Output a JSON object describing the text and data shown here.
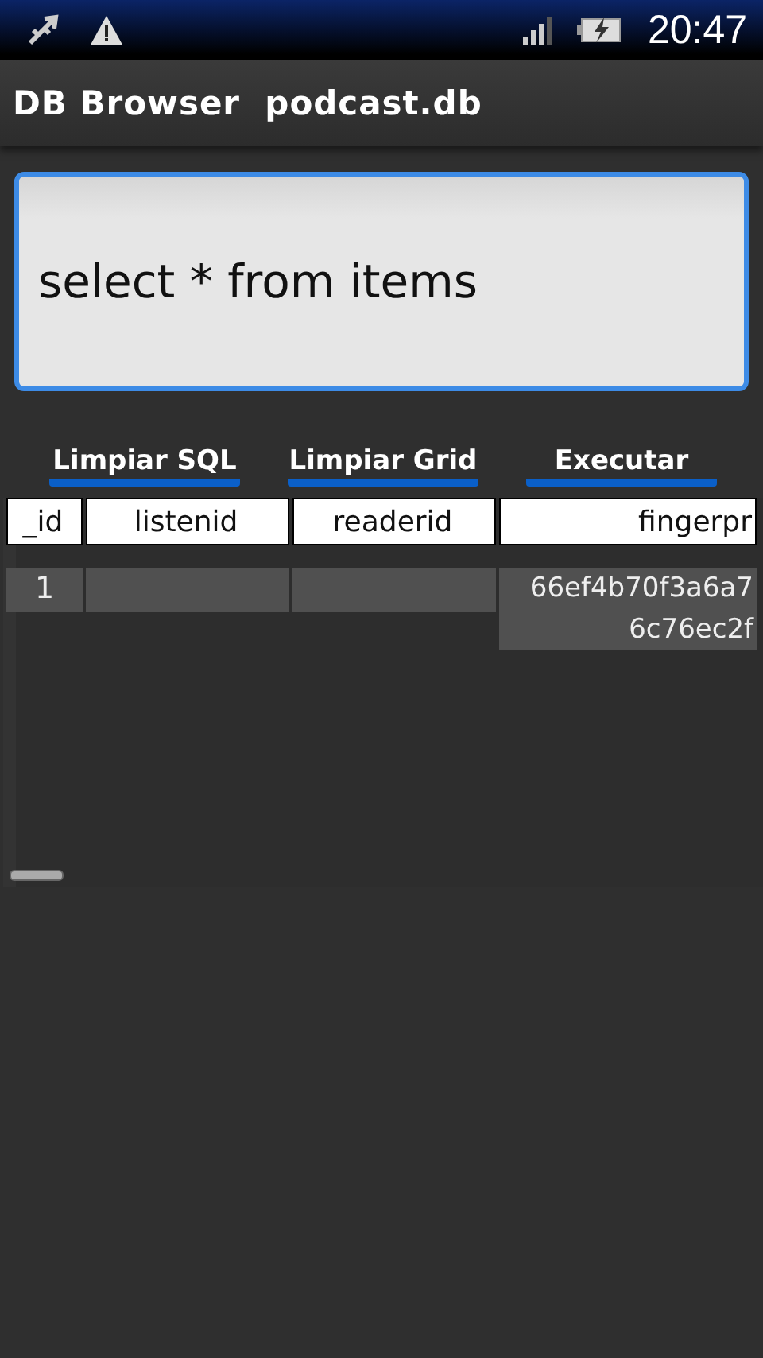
{
  "status_bar": {
    "time": "20:47"
  },
  "app_bar": {
    "title": "DB Browser  podcast.db"
  },
  "sql_field": {
    "value": "select * from items"
  },
  "buttons": [
    "Limpiar SQL",
    "Limpiar Grid",
    "Executar"
  ],
  "table": {
    "columns": [
      "_id",
      "listenid",
      "readerid",
      "fingerpr"
    ],
    "rows": [
      [
        "1",
        "",
        "",
        "66ef4b70f3a6a7\n6c76ec2f"
      ]
    ]
  }
}
